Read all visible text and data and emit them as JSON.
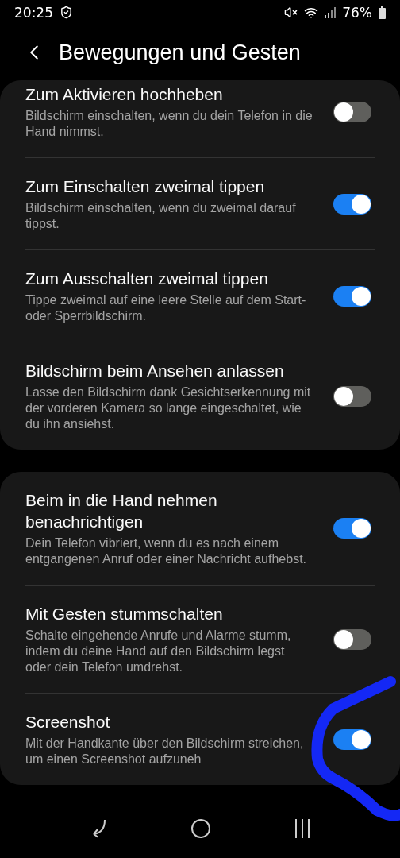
{
  "status_bar": {
    "time": "20:25",
    "battery": "76%"
  },
  "header": {
    "title": "Bewegungen und Gesten"
  },
  "sections": [
    {
      "items": [
        {
          "title": "Zum Aktivieren hochheben",
          "description": "Bildschirm einschalten, wenn du dein Telefon in die Hand nimmst.",
          "on": false
        },
        {
          "title": "Zum Einschalten zweimal tippen",
          "description": "Bildschirm einschalten, wenn du zweimal darauf tippst.",
          "on": true
        },
        {
          "title": "Zum Ausschalten zweimal tippen",
          "description": "Tippe zweimal auf eine leere Stelle auf dem Start- oder Sperrbildschirm.",
          "on": true
        },
        {
          "title": "Bildschirm beim Ansehen anlassen",
          "description": "Lasse den Bildschirm dank Gesichtserkennung mit der vorderen Kamera so lange eingeschaltet, wie du ihn ansiehst.",
          "on": false
        }
      ]
    },
    {
      "items": [
        {
          "title": "Beim in die Hand nehmen benachrichtigen",
          "description": "Dein Telefon vibriert, wenn du es nach einem entgangenen Anruf oder einer Nachricht aufhebst.",
          "on": true
        },
        {
          "title": "Mit Gesten stummschalten",
          "description": "Schalte eingehende Anrufe und Alarme stumm, indem du deine Hand auf den Bildschirm legst oder dein Telefon umdrehst.",
          "on": false
        },
        {
          "title": "Screenshot",
          "description": "Mit der Handkante über den Bildschirm streichen, um einen Screenshot aufzuneh",
          "on": true
        }
      ]
    }
  ]
}
